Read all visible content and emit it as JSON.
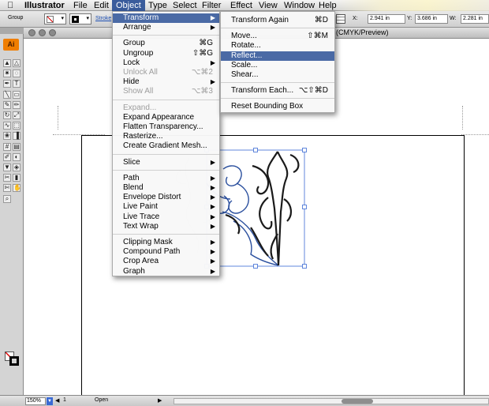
{
  "menubar": {
    "apple_icon": "apple-logo",
    "app_name": "Illustrator",
    "items": [
      "File",
      "Edit",
      "Object",
      "Type",
      "Select",
      "Filter",
      "Effect",
      "View",
      "Window",
      "Help"
    ]
  },
  "controlbar": {
    "selection_label": "Group",
    "stroke_label": "Stroke",
    "x_label": "X:",
    "x_value": "2.941 in",
    "y_label": "Y:",
    "y_value": "3.686 in",
    "w_label": "W:",
    "w_value": "2.281 in"
  },
  "document": {
    "title_suffix": "(CMYK/Preview)"
  },
  "statusbar": {
    "zoom": "150%",
    "page": "1",
    "status": "Open"
  },
  "object_menu": {
    "groups": [
      [
        {
          "label": "Transform",
          "submenu": true,
          "highlighted": true
        },
        {
          "label": "Arrange",
          "submenu": true
        }
      ],
      [
        {
          "label": "Group",
          "shortcut": "⌘G"
        },
        {
          "label": "Ungroup",
          "shortcut": "⇧⌘G"
        },
        {
          "label": "Lock",
          "submenu": true
        },
        {
          "label": "Unlock All",
          "shortcut": "⌥⌘2",
          "disabled": true
        },
        {
          "label": "Hide",
          "submenu": true
        },
        {
          "label": "Show All",
          "shortcut": "⌥⌘3",
          "disabled": true
        }
      ],
      [
        {
          "label": "Expand...",
          "disabled": true
        },
        {
          "label": "Expand Appearance"
        },
        {
          "label": "Flatten Transparency..."
        },
        {
          "label": "Rasterize..."
        },
        {
          "label": "Create Gradient Mesh..."
        }
      ],
      [
        {
          "label": "Slice",
          "submenu": true
        }
      ],
      [
        {
          "label": "Path",
          "submenu": true
        },
        {
          "label": "Blend",
          "submenu": true
        },
        {
          "label": "Envelope Distort",
          "submenu": true
        },
        {
          "label": "Live Paint",
          "submenu": true
        },
        {
          "label": "Live Trace",
          "submenu": true
        },
        {
          "label": "Text Wrap",
          "submenu": true
        }
      ],
      [
        {
          "label": "Clipping Mask",
          "submenu": true
        },
        {
          "label": "Compound Path",
          "submenu": true
        },
        {
          "label": "Crop Area",
          "submenu": true
        },
        {
          "label": "Graph",
          "submenu": true
        }
      ]
    ]
  },
  "transform_menu": {
    "groups": [
      [
        {
          "label": "Transform Again",
          "shortcut": "⌘D"
        }
      ],
      [
        {
          "label": "Move...",
          "shortcut": "⇧⌘M"
        },
        {
          "label": "Rotate..."
        },
        {
          "label": "Reflect...",
          "highlighted": true
        },
        {
          "label": "Scale..."
        },
        {
          "label": "Shear..."
        }
      ],
      [
        {
          "label": "Transform Each...",
          "shortcut": "⌥⇧⌘D"
        }
      ],
      [
        {
          "label": "Reset Bounding Box"
        }
      ]
    ]
  },
  "tools": [
    "selection",
    "direct-selection",
    "magic-wand",
    "lasso",
    "pen",
    "type",
    "line",
    "rectangle",
    "paintbrush",
    "pencil",
    "rotate",
    "scale",
    "warp",
    "free-transform",
    "symbol-sprayer",
    "column-graph",
    "mesh",
    "gradient",
    "eyedropper",
    "blend",
    "live-paint-bucket",
    "live-paint-selection",
    "slice",
    "eraser",
    "scissors",
    "hand",
    "zoom"
  ],
  "colors": {
    "menu_highlight": "#4a6aa5",
    "menubar_active": "#3a5c9c",
    "artwork_stroke": "#1a1a1a",
    "artwork_blue": "#2a4f9e"
  }
}
